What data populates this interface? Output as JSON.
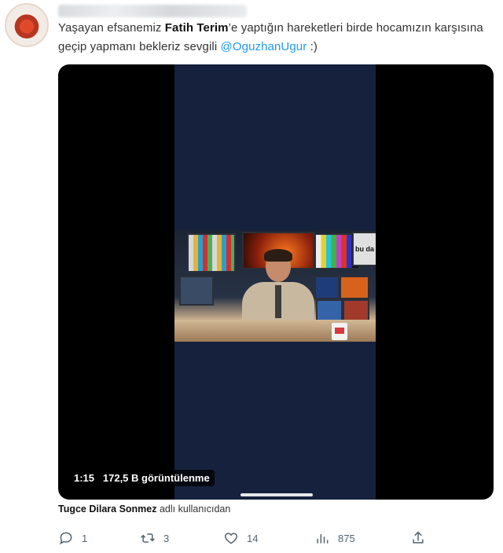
{
  "tweet": {
    "text_before": "Yaşayan efsanemiz ",
    "bold_name": "Fatih Terim",
    "text_middle": "’e yaptığın hareketleri birde hocamızın karşısına geçip yapmanı bekleriz sevgili ",
    "mention": "@OguzhanUgur",
    "text_after": " :)"
  },
  "media": {
    "duration": "1:15",
    "views": "172,5 B görüntülenme",
    "watermark": "bu da"
  },
  "voice_credit": {
    "name": "Tugce Dilara Sonmez",
    "suffix": "adlı kullanıcıdan"
  },
  "actions": {
    "reply_count": "1",
    "retweet_count": "3",
    "like_count": "14",
    "views_count": "875"
  },
  "icons": [
    "reply-icon",
    "retweet-icon",
    "like-icon",
    "analytics-icon",
    "share-icon"
  ],
  "colors": {
    "mention": "#1d9bf0",
    "icon": "#536471",
    "video_bg": "#15213d"
  }
}
